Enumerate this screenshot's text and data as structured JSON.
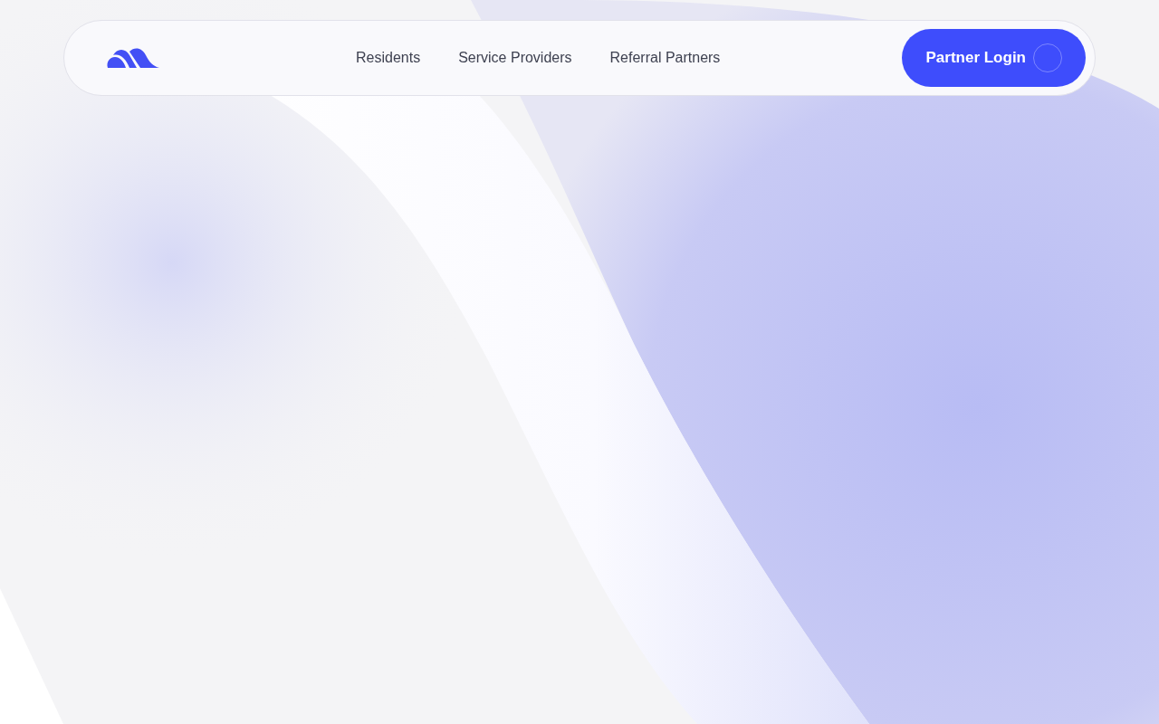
{
  "nav": {
    "links": [
      "Residents",
      "Service Providers",
      "Referral Partners"
    ],
    "button": "Partner Login"
  }
}
